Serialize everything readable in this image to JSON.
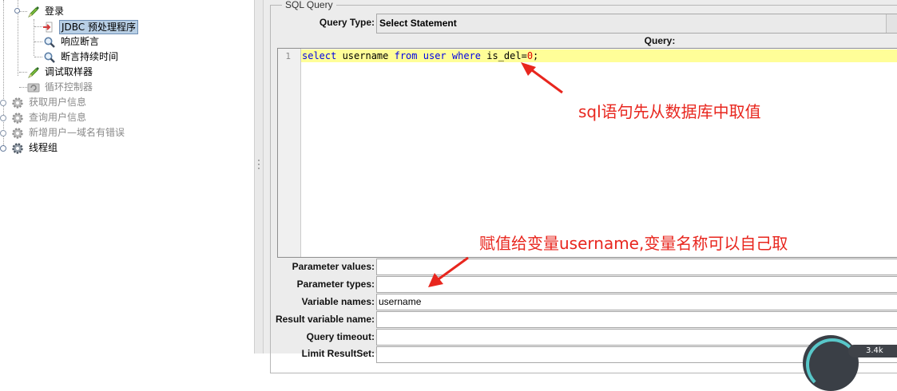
{
  "tree": {
    "items": [
      {
        "label": "登录",
        "icon": "pencil-icon",
        "level": 1,
        "dim": false,
        "selected": false
      },
      {
        "label": "JDBC 预处理程序",
        "icon": "jdbc-preprocessor-icon",
        "level": 2,
        "dim": false,
        "selected": true
      },
      {
        "label": "响应断言",
        "icon": "magnifier-icon",
        "level": 2,
        "dim": false,
        "selected": false
      },
      {
        "label": "断言持续时间",
        "icon": "magnifier-icon",
        "level": 2,
        "dim": false,
        "selected": false
      },
      {
        "label": "调试取样器",
        "icon": "pencil-icon",
        "level": 1,
        "dim": false,
        "selected": false
      },
      {
        "label": "循环控制器",
        "icon": "loop-controller-icon",
        "level": 1,
        "dim": true,
        "selected": false
      },
      {
        "label": "获取用户信息",
        "icon": "gear-icon",
        "level": 0,
        "dim": true,
        "selected": false
      },
      {
        "label": "查询用户信息",
        "icon": "gear-icon",
        "level": 0,
        "dim": true,
        "selected": false
      },
      {
        "label": "新增用户—域名有错误",
        "icon": "gear-icon",
        "level": 0,
        "dim": true,
        "selected": false
      },
      {
        "label": "线程组",
        "icon": "gear-icon",
        "level": 0,
        "dim": false,
        "selected": false
      }
    ]
  },
  "sql": {
    "group_title": "SQL Query",
    "query_type_label": "Query Type:",
    "query_type_value": "Select Statement",
    "query_label": "Query:",
    "line_number": "1",
    "code": [
      {
        "text": "select",
        "cls": "kw"
      },
      {
        "text": " username ",
        "cls": "plain"
      },
      {
        "text": "from",
        "cls": "kw"
      },
      {
        "text": " ",
        "cls": "plain"
      },
      {
        "text": "user",
        "cls": "kw"
      },
      {
        "text": " ",
        "cls": "plain"
      },
      {
        "text": "where",
        "cls": "kw"
      },
      {
        "text": " is_del=",
        "cls": "plain"
      },
      {
        "text": "0",
        "cls": "num"
      },
      {
        "text": ";",
        "cls": "plain"
      }
    ]
  },
  "fields": {
    "parameter_values": {
      "label": "Parameter values:",
      "value": ""
    },
    "parameter_types": {
      "label": "Parameter types:",
      "value": ""
    },
    "variable_names": {
      "label": "Variable names:",
      "value": "username"
    },
    "result_variable_name": {
      "label": "Result variable name:",
      "value": ""
    },
    "query_timeout": {
      "label": "Query timeout:",
      "value": ""
    },
    "limit_resultset": {
      "label": "Limit ResultSet:",
      "value": ""
    }
  },
  "annotations": {
    "note1": "sql语句先从数据库中取值",
    "note2": "赋值给变量username,变量名称可以自己取"
  },
  "colors": {
    "annotation": "#e8261e",
    "keyword": "#0000e6",
    "number": "#e00000",
    "line_highlight": "#fffe98"
  },
  "overlay": {
    "text": "3.4k"
  }
}
